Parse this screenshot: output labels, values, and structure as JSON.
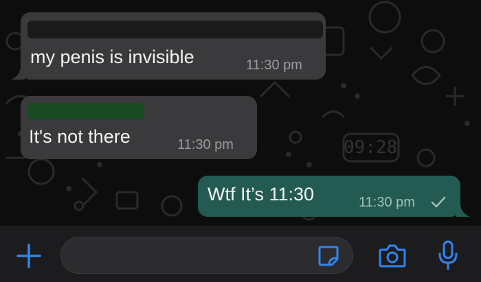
{
  "messages": [
    {
      "type": "incoming",
      "text": "my penis is invisible",
      "time": "11:30 pm",
      "sender_redacted": true
    },
    {
      "type": "incoming",
      "text": "It's not there",
      "time": "11:30 pm",
      "sender_redacted": true
    },
    {
      "type": "outgoing",
      "text": "Wtf It’s 11:30",
      "time": "11:30 pm",
      "status": "sent-check"
    }
  ],
  "input": {
    "placeholder": ""
  },
  "icons": {
    "add": "plus-icon",
    "sticker": "sticker-icon",
    "camera": "camera-icon",
    "mic": "microphone-icon",
    "status": "checkmark-icon"
  },
  "colors": {
    "accent": "#2f86f0",
    "incoming_bubble": "#3a3a3c",
    "outgoing_bubble": "#235a52",
    "background": "#0d0d0d"
  }
}
